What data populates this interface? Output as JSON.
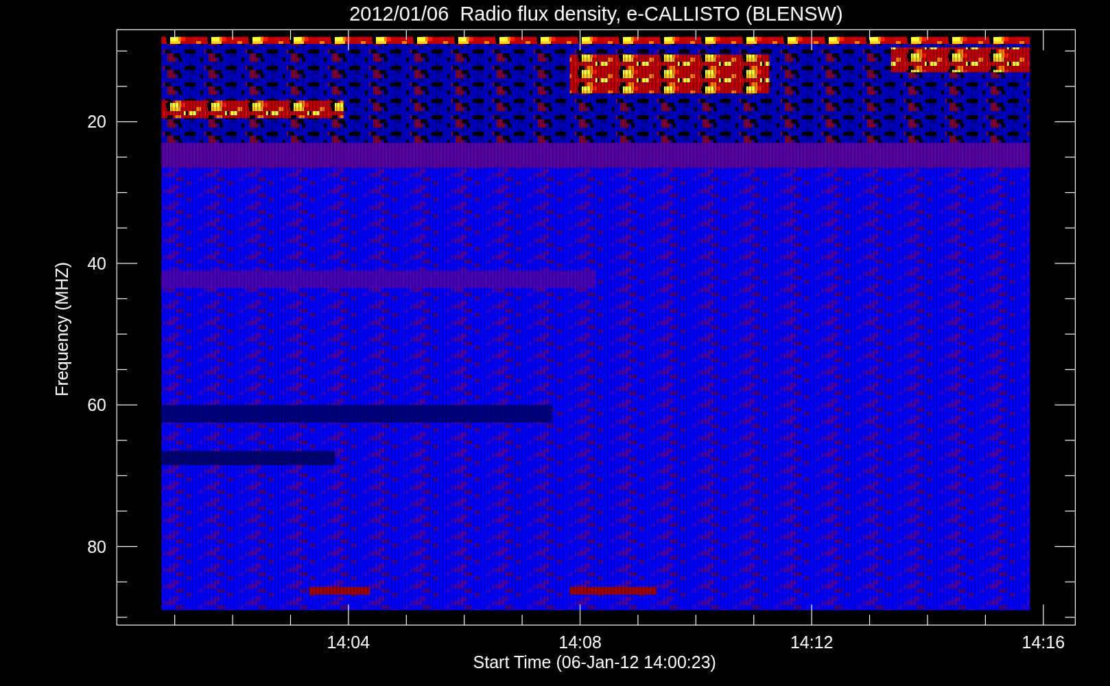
{
  "title": "2012/01/06  Radio flux density, e-CALLISTO (BLENSW)",
  "y_axis": {
    "label": "Frequency (MHZ)",
    "ticks": [
      "20",
      "40",
      "60",
      "80"
    ]
  },
  "x_axis": {
    "label": "Start Time (06-Jan-12 14:00:23)",
    "ticks": [
      "14:04",
      "14:08",
      "14:12",
      "14:16"
    ]
  }
}
